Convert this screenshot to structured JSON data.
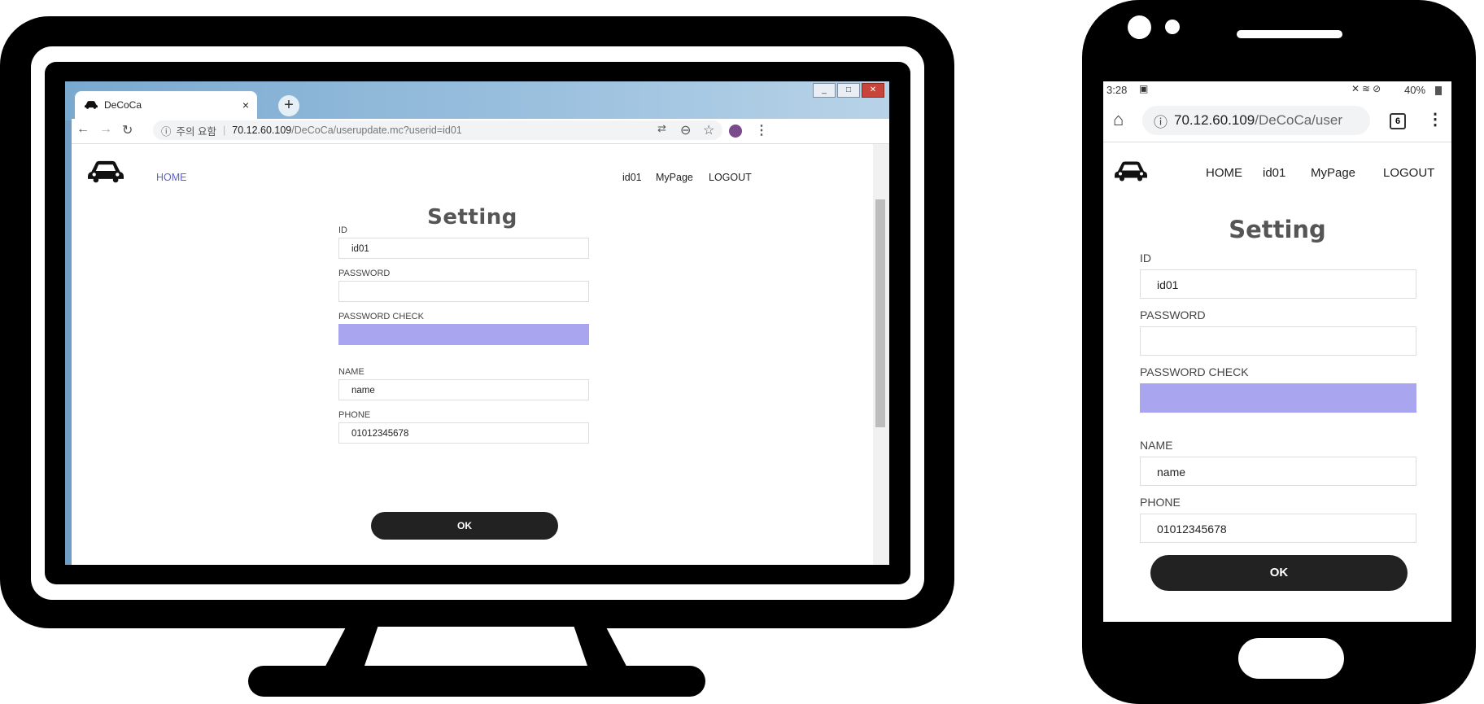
{
  "desktop": {
    "tab": {
      "title": "DeCoCa",
      "close": "×"
    },
    "newtab": "+",
    "window_controls": [
      "_",
      "□",
      "✕"
    ],
    "omnibox": {
      "security": "주의 요함",
      "host": "70.12.60.109",
      "path": "/DeCoCa/userupdate.mc?userid=id01"
    }
  },
  "nav": {
    "home": "HOME",
    "user": "id01",
    "mypage": "MyPage",
    "logout": "LOGOUT"
  },
  "form": {
    "title": "Setting",
    "id_label": "ID",
    "id_value": "id01",
    "password_label": "PASSWORD",
    "password_value": "",
    "password_check_label": "PASSWORD CHECK",
    "password_check_value": "",
    "name_label": "NAME",
    "name_value": "name",
    "phone_label": "PHONE",
    "phone_value": "01012345678",
    "ok_label": "OK"
  },
  "phone": {
    "status": {
      "time": "3:28",
      "battery": "40%"
    },
    "url": {
      "host": "70.12.60.109",
      "path": "/DeCoCa/user"
    },
    "tabs_count": "6"
  },
  "colors": {
    "accent_nav": "#5b62c9",
    "highlight_field": "#a9a6ef",
    "button_bg": "#222222"
  }
}
